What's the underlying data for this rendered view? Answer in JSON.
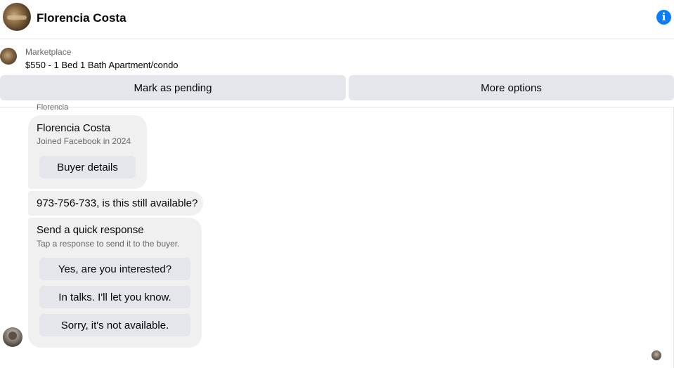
{
  "header": {
    "contact_name": "Florencia Costa",
    "info_icon": "i"
  },
  "marketplace": {
    "label": "Marketplace",
    "listing_title": "$550 - 1 Bed 1 Bath Apartment/condo",
    "actions": {
      "mark_pending": "Mark as pending",
      "more_options": "More options"
    }
  },
  "thread": {
    "sender_label": "Florencia",
    "buyer_card": {
      "name": "Florencia Costa",
      "joined": "Joined Facebook in 2024",
      "button": "Buyer details"
    },
    "message": "973-756-733, is this still available?",
    "quick_response": {
      "title": "Send a quick response",
      "subtitle": "Tap a response to send it to the buyer.",
      "options": [
        "Yes, are you interested?",
        "In talks. I'll let you know.",
        "Sorry, it's not available."
      ]
    }
  },
  "colors": {
    "accent": "#0a7cff",
    "bubble_bg": "#f0f0f0",
    "button_bg": "#e4e6eb",
    "secondary_text": "#65676b"
  }
}
